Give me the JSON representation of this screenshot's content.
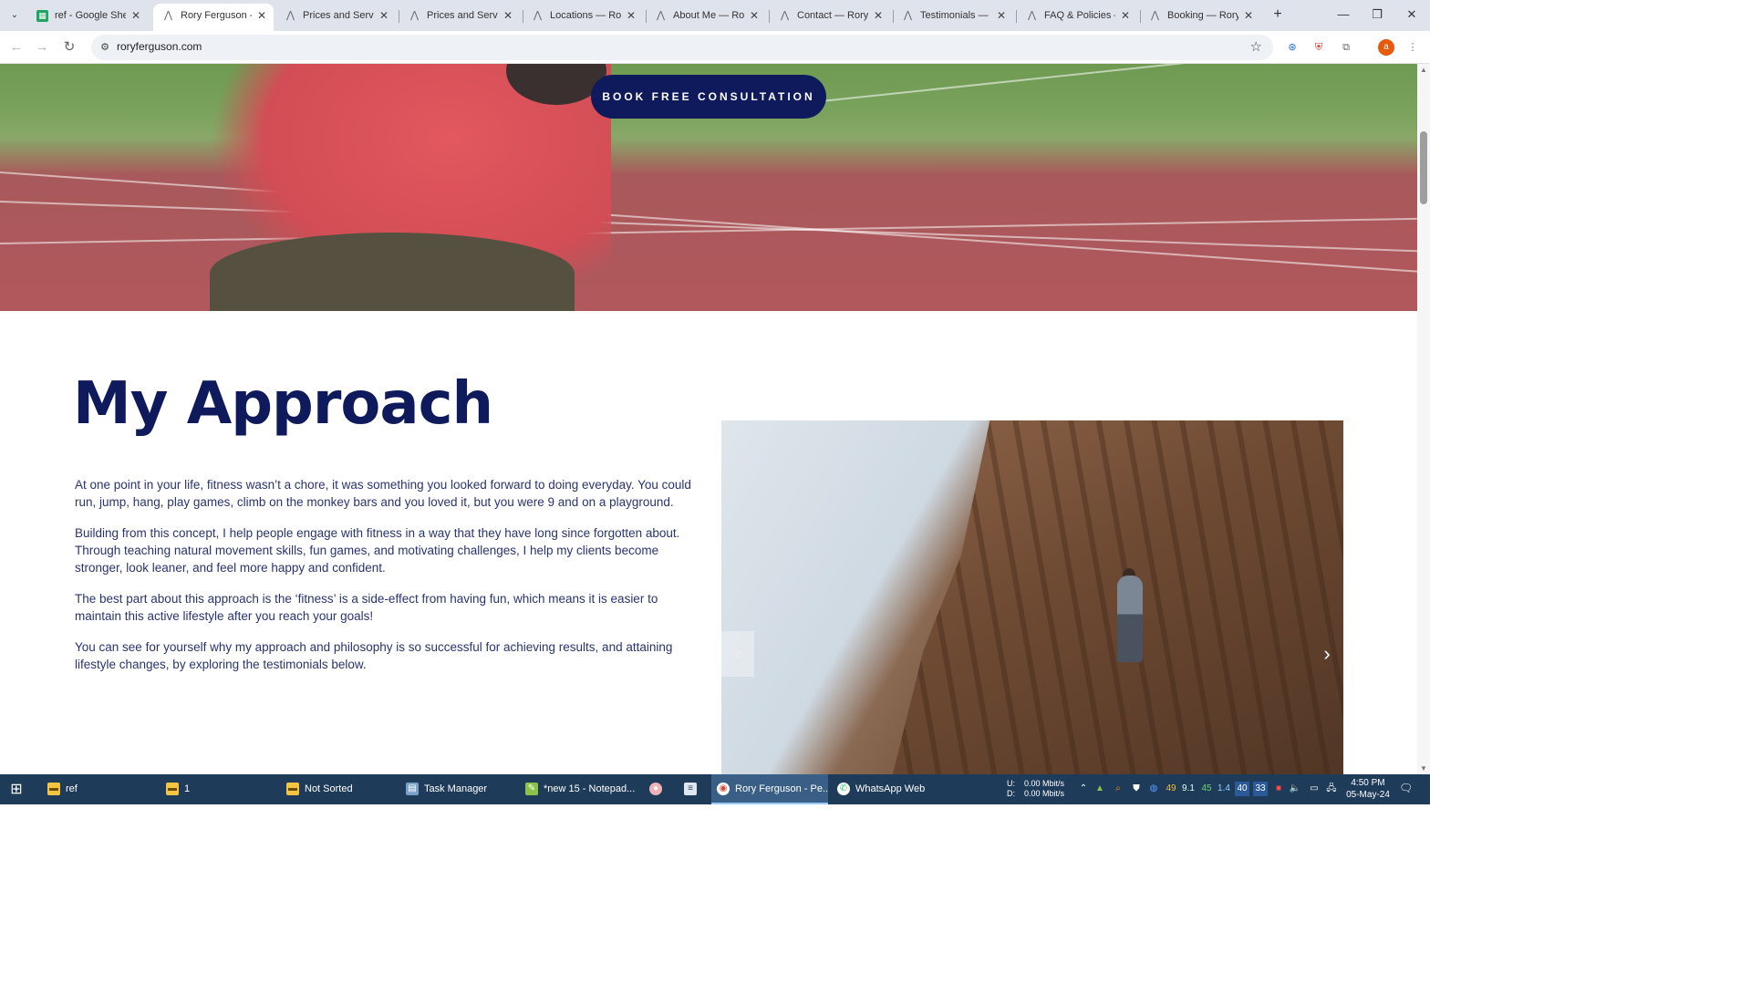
{
  "browser": {
    "tabs": [
      {
        "title": "ref - Google Shee",
        "icon": "sheets-icon",
        "active": false
      },
      {
        "title": "Rory Ferguson - P",
        "icon": "site-icon",
        "active": true
      },
      {
        "title": "Prices and Service",
        "icon": "site-icon",
        "active": false
      },
      {
        "title": "Prices and Service",
        "icon": "site-icon",
        "active": false
      },
      {
        "title": "Locations — Rory",
        "icon": "site-icon",
        "active": false
      },
      {
        "title": "About Me — Rory",
        "icon": "site-icon",
        "active": false
      },
      {
        "title": "Contact — Rory F",
        "icon": "site-icon",
        "active": false
      },
      {
        "title": "Testimonials — R",
        "icon": "site-icon",
        "active": false
      },
      {
        "title": "FAQ & Policies —",
        "icon": "site-icon",
        "active": false
      },
      {
        "title": "Booking — Rory F",
        "icon": "site-icon",
        "active": false
      }
    ],
    "url": "roryferguson.com",
    "profile_initial": "a"
  },
  "page": {
    "cta_label": "BOOK FREE CONSULTATION",
    "heading": "My Approach",
    "paragraphs": [
      "At one point in your life, fitness wasn’t a chore, it was something you looked forward to doing everyday. You could run, jump, hang, play games, climb on the monkey bars and you loved it, but you were 9 and on a playground.",
      "Building from this concept, I help people engage with fitness in a way that they have long since forgotten about. Through teaching natural movement skills, fun games, and motivating challenges, I help my clients become stronger, look leaner, and feel more happy and confident.",
      "The best part about this approach is the ‘fitness’ is a side-effect from having fun, which means it is easier to maintain this active lifestyle after you reach your goals!",
      "You can see for yourself why my approach and philosophy is so successful for achieving results, and attaining lifestyle changes, by exploring the testimonials below."
    ],
    "colors": {
      "navy": "#0f1a5c",
      "button": "#0e1a5c",
      "body_text": "#2a3470"
    }
  },
  "taskbar": {
    "items": [
      {
        "label": "ref",
        "icon": "folder-icon"
      },
      {
        "label": "1",
        "icon": "folder-icon"
      },
      {
        "label": "Not Sorted",
        "icon": "folder-icon"
      },
      {
        "label": "Task Manager",
        "icon": "task-manager-icon"
      },
      {
        "label": "*new 15 - Notepad...",
        "icon": "notepad-icon"
      },
      {
        "label": "Rory Ferguson - Pe...",
        "icon": "chrome-icon"
      },
      {
        "label": "WhatsApp Web",
        "icon": "whatsapp-icon"
      }
    ],
    "net_up_label": "U:",
    "net_down_label": "D:",
    "net_up": "0.00 Mbit/s",
    "net_down": "0.00 Mbit/s",
    "tray_numbers": [
      "49",
      "9.1",
      "45",
      "1.4",
      "40",
      "33"
    ],
    "time": "4:50 PM",
    "date": "05-May-24"
  }
}
